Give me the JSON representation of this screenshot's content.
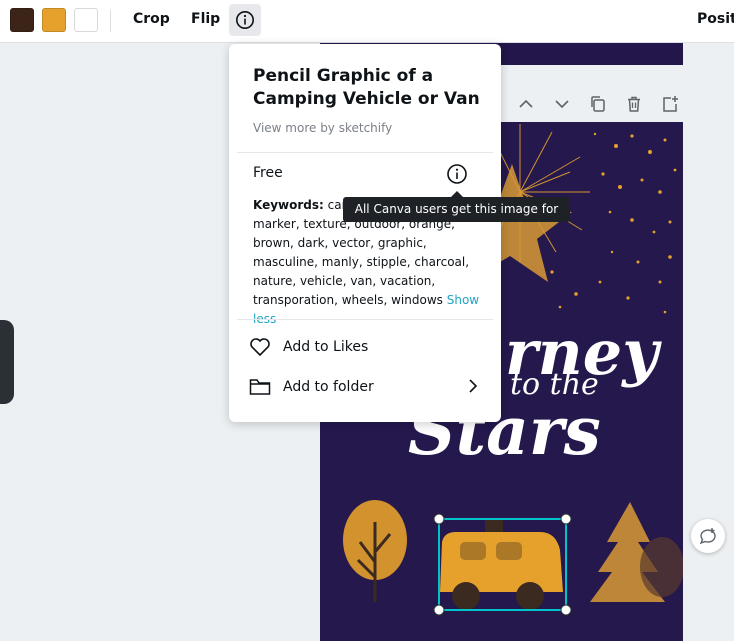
{
  "toolbar": {
    "swatches": [
      "#3d2418",
      "#e6a12c",
      "#ffffff"
    ],
    "crop_label": "Crop",
    "flip_label": "Flip",
    "position_label": "Positi"
  },
  "popover": {
    "title": "Pencil Graphic of a Camping Vehicle or Van",
    "author": "View more by sketchify",
    "price": "Free",
    "keywords_label": "Keywords:",
    "keywords_visible_before_tooltip": "cam",
    "keywords_rest": "marker, texture, outdoor, orange, brown, dark, vector, graphic, masculine, manly, stipple, charcoal, nature, vehicle, van, vacation, transporation, wheels, windows",
    "show_less": "Show less",
    "add_likes": "Add to Likes",
    "add_folder": "Add to folder"
  },
  "tooltip": {
    "text": "All Canva users get this image for free"
  },
  "design": {
    "title_line1": "rney",
    "title_line2": "to the",
    "title_line3": "Stars"
  },
  "colors": {
    "design_bg": "#24184d",
    "accent_gold": "#e6a12c",
    "link": "#20a4c4",
    "selection": "#00c4cc"
  }
}
